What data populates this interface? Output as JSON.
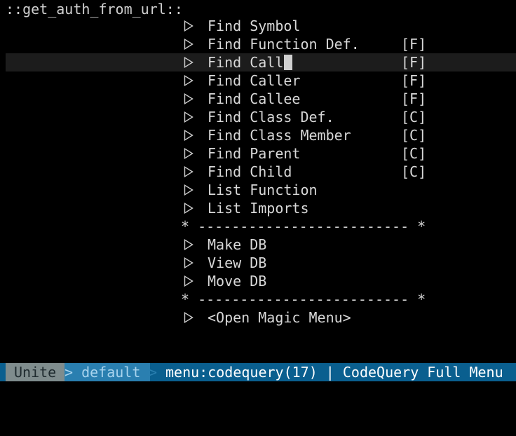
{
  "prompt": {
    "text": "::get_auth_from_url::"
  },
  "menu": {
    "items": [
      {
        "label": "Find Symbol",
        "tag": ""
      },
      {
        "label": "Find Function Def.",
        "tag": "[F]"
      },
      {
        "label": "Find Call",
        "tag": "[F]",
        "selected": true
      },
      {
        "label": "Find Caller",
        "tag": "[F]"
      },
      {
        "label": "Find Callee",
        "tag": "[F]"
      },
      {
        "label": "Find Class Def.",
        "tag": "[C]"
      },
      {
        "label": "Find Class Member",
        "tag": "[C]"
      },
      {
        "label": "Find Parent",
        "tag": "[C]"
      },
      {
        "label": "Find Child",
        "tag": "[C]"
      },
      {
        "label": "List Function",
        "tag": ""
      },
      {
        "label": "List Imports",
        "tag": ""
      },
      {
        "separator": "* ------------------------- *"
      },
      {
        "label": "Make DB",
        "tag": ""
      },
      {
        "label": "View DB",
        "tag": ""
      },
      {
        "label": "Move DB",
        "tag": ""
      },
      {
        "separator": "* ------------------------- *"
      },
      {
        "label": "<Open Magic Menu>",
        "tag": ""
      }
    ]
  },
  "statusbar": {
    "mode": "Unite",
    "buffer": "> default",
    "info_separator": ">",
    "info": "menu:codequery(17) | CodeQuery Full Menu"
  },
  "icons": {
    "menu_item_icon": "triangle-right-outline-icon"
  },
  "colors": {
    "background": "#000000",
    "text": "#cfcfcf",
    "selected_row": "#1c1c1c",
    "status_bar": "#0a5f8f",
    "mode_segment": "#7f8c8d",
    "buffer_segment": "#2a7fb0"
  }
}
